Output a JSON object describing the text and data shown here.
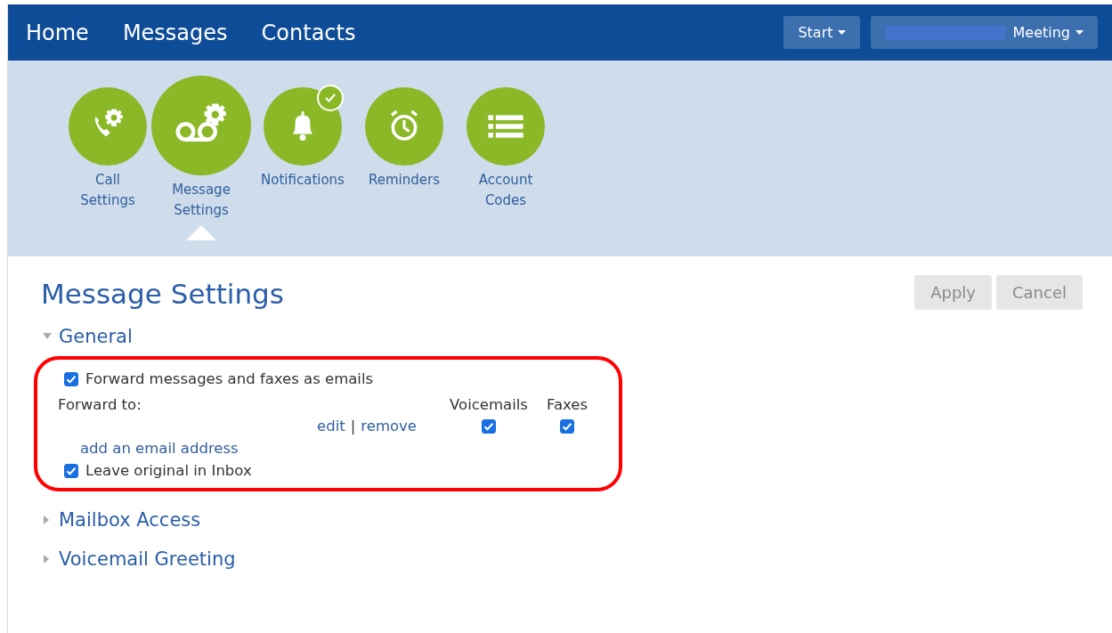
{
  "nav": {
    "items": [
      {
        "label": "Home"
      },
      {
        "label": "Messages"
      },
      {
        "label": "Contacts"
      }
    ],
    "buttons": [
      {
        "label": "Start",
        "redacted": false
      },
      {
        "label": "Meeting",
        "redacted": true
      }
    ]
  },
  "features": [
    {
      "kind": "call-settings",
      "label": "Call\nSettings",
      "selected": false,
      "checked": false
    },
    {
      "kind": "message-settings",
      "label": "Message\nSettings",
      "selected": true,
      "checked": false
    },
    {
      "kind": "notifications",
      "label": "Notifications",
      "selected": false,
      "checked": true
    },
    {
      "kind": "reminders",
      "label": "Reminders",
      "selected": false,
      "checked": false
    },
    {
      "kind": "account-codes",
      "label": "Account\nCodes",
      "selected": false,
      "checked": false
    }
  ],
  "page": {
    "title": "Message Settings",
    "buttons": [
      {
        "label": "Apply",
        "disabled": true
      },
      {
        "label": "Cancel",
        "disabled": true
      }
    ]
  },
  "sections": [
    {
      "title": "General",
      "expanded": true,
      "highlighted": true,
      "forward": {
        "label": "Forward messages and faxes as emails",
        "checked": true
      },
      "forward_to": "Forward to:",
      "columns": [
        "Voicemails",
        "Faxes"
      ],
      "addresses": [
        {
          "edit": "edit",
          "separator": "|",
          "remove": "remove",
          "voicemails": true,
          "faxes": true
        }
      ],
      "add_link": "add an email address",
      "leave": {
        "label": "Leave original in Inbox",
        "checked": true
      }
    },
    {
      "title": "Mailbox Access",
      "expanded": false
    },
    {
      "title": "Voicemail Greeting",
      "expanded": false
    }
  ]
}
